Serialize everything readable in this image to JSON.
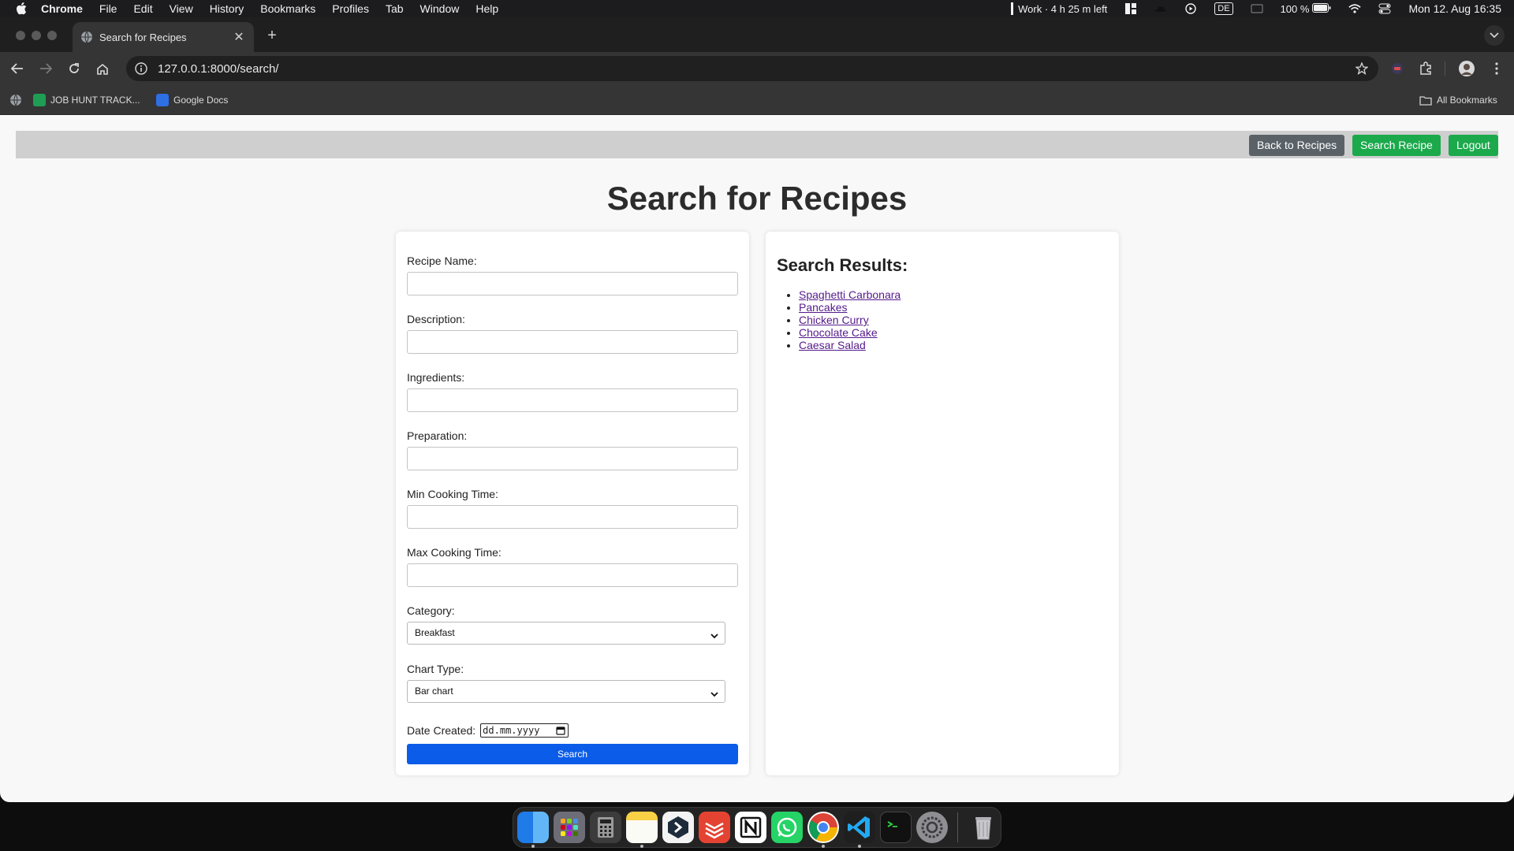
{
  "menubar": {
    "app_name": "Chrome",
    "items": [
      "File",
      "Edit",
      "View",
      "History",
      "Bookmarks",
      "Profiles",
      "Tab",
      "Window",
      "Help"
    ],
    "focus_timer": "Work · 4 h 25 m left",
    "keyboard_layout": "DE",
    "battery": "100 %",
    "datetime": "Mon 12. Aug  16:35"
  },
  "browser": {
    "tab_title": "Search for Recipes",
    "url": "127.0.0.1:8000/search/",
    "bookmarks": [
      "JOB HUNT TRACK...",
      "Google Docs"
    ],
    "all_bookmarks": "All Bookmarks"
  },
  "nav": {
    "back_to_recipes": "Back to Recipes",
    "search_recipe": "Search Recipe",
    "logout": "Logout",
    "back_color": "#5a6268",
    "green_color": "#1ba94c"
  },
  "page": {
    "title": "Search for Recipes"
  },
  "form": {
    "recipe_name_label": "Recipe Name:",
    "recipe_name_value": "",
    "description_label": "Description:",
    "description_value": "",
    "ingredients_label": "Ingredients:",
    "ingredients_value": "",
    "preparation_label": "Preparation:",
    "preparation_value": "",
    "min_time_label": "Min Cooking Time:",
    "min_time_value": "",
    "max_time_label": "Max Cooking Time:",
    "max_time_value": "",
    "category_label": "Category:",
    "category_value": "Breakfast",
    "chart_type_label": "Chart Type:",
    "chart_type_value": "Bar chart",
    "date_label": "Date Created:",
    "date_placeholder": "dd.mm.yyyy",
    "search_button": "Search",
    "button_color": "#0b5ce8"
  },
  "results": {
    "title": "Search Results:",
    "items": [
      "Spaghetti Carbonara",
      "Pancakes",
      "Chicken Curry",
      "Chocolate Cake",
      "Caesar Salad"
    ],
    "link_color": "#551a8b"
  },
  "dock": {
    "apps": [
      "finder-icon",
      "launchpad-icon",
      "calculator-icon",
      "notes-icon",
      "dev-app-icon",
      "todoist-icon",
      "notion-icon",
      "whatsapp-icon",
      "chrome-icon",
      "vscode-icon",
      "terminal-icon",
      "settings-icon",
      "trash-icon"
    ]
  }
}
